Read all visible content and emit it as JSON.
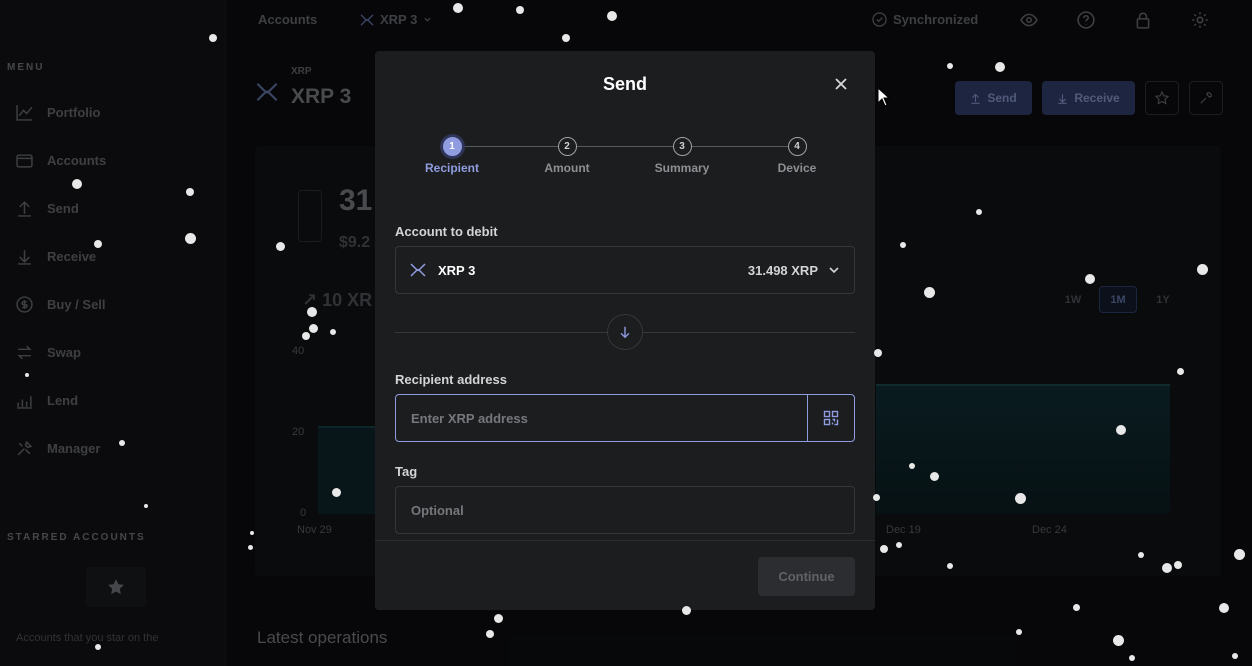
{
  "sidebar": {
    "menu_label": "MENU",
    "items": [
      {
        "label": "Portfolio",
        "icon": "chart-icon"
      },
      {
        "label": "Accounts",
        "icon": "wallet-icon"
      },
      {
        "label": "Send",
        "icon": "arrow-up-icon"
      },
      {
        "label": "Receive",
        "icon": "arrow-down-icon"
      },
      {
        "label": "Buy / Sell",
        "icon": "dollar-icon"
      },
      {
        "label": "Swap",
        "icon": "swap-icon"
      },
      {
        "label": "Lend",
        "icon": "bars-icon"
      },
      {
        "label": "Manager",
        "icon": "tools-icon"
      }
    ],
    "starred_label": "STARRED ACCOUNTS",
    "starred_hint": "Accounts that you star on the"
  },
  "topbar": {
    "crumb_accounts": "Accounts",
    "crumb_account": "XRP 3",
    "sync_status": "Synchronized"
  },
  "account": {
    "ticker": "XRP",
    "name": "XRP 3",
    "balance_partial": "31",
    "fiat_partial": "$9.2",
    "change_partial": "10 XR",
    "send_label": "Send",
    "receive_label": "Receive",
    "y_ticks": [
      "40",
      "20",
      "0"
    ],
    "x_ticks": [
      "Nov 29",
      "Dec 19",
      "Dec 24"
    ],
    "ranges": [
      "1W",
      "1M",
      "1Y"
    ],
    "active_range": "1M",
    "latest_ops": "Latest operations"
  },
  "modal": {
    "title": "Send",
    "steps": [
      {
        "num": "1",
        "label": "Recipient",
        "active": true
      },
      {
        "num": "2",
        "label": "Amount",
        "active": false
      },
      {
        "num": "3",
        "label": "Summary",
        "active": false
      },
      {
        "num": "4",
        "label": "Device",
        "active": false
      }
    ],
    "account_label": "Account to debit",
    "account_name": "XRP 3",
    "account_balance": "31.498 XRP",
    "recipient_label": "Recipient address",
    "recipient_placeholder": "Enter XRP address",
    "tag_label": "Tag",
    "tag_placeholder": "Optional",
    "continue_label": "Continue"
  },
  "colors": {
    "accent": "#8f9ce0",
    "modal_bg": "#1c1d1f",
    "page_bg": "#0b0c0e"
  }
}
